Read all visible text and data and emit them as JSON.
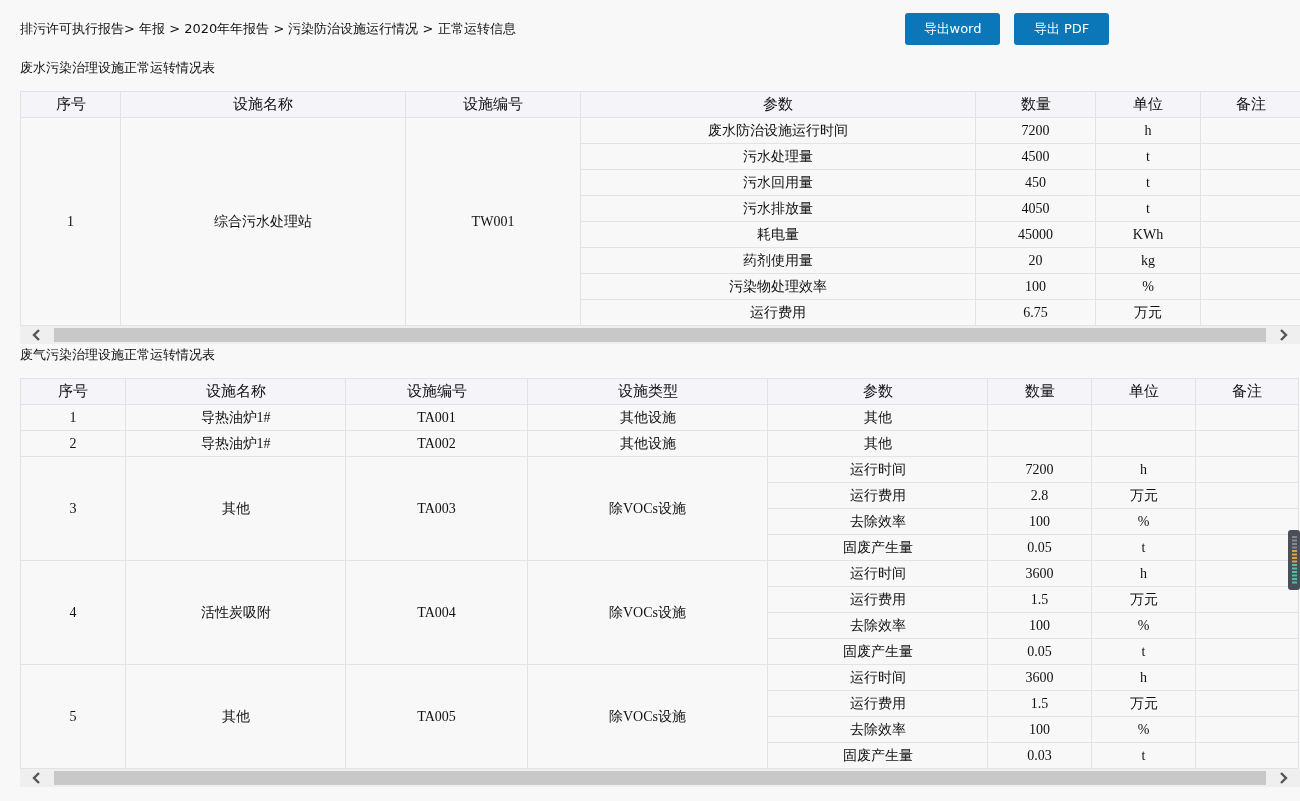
{
  "breadcrumb": "排污许可执行报告> 年报 > 2020年年报告 > 污染防治设施运行情况 > 正常运转信息",
  "buttons": [
    "导出word",
    "导出 PDF"
  ],
  "tables": [
    {
      "title": "废水污染治理设施正常运转情况表",
      "columns": [
        "序号",
        "设施名称",
        "设施编号",
        "参数",
        "数量",
        "单位",
        "备注"
      ],
      "rows": [
        {
          "no": "1",
          "name": "综合污水处理站",
          "code": "TW001",
          "params": [
            {
              "param": "废水防治设施运行时间",
              "qty": "7200",
              "unit": "h"
            },
            {
              "param": "污水处理量",
              "qty": "4500",
              "unit": "t"
            },
            {
              "param": "污水回用量",
              "qty": "450",
              "unit": "t"
            },
            {
              "param": "污水排放量",
              "qty": "4050",
              "unit": "t"
            },
            {
              "param": "耗电量",
              "qty": "45000",
              "unit": "KWh"
            },
            {
              "param": "药剂使用量",
              "qty": "20",
              "unit": "kg"
            },
            {
              "param": "污染物处理效率",
              "qty": "100",
              "unit": "%"
            },
            {
              "param": "运行费用",
              "qty": "6.75",
              "unit": "万元"
            }
          ]
        }
      ]
    },
    {
      "title": "废气污染治理设施正常运转情况表",
      "columns": [
        "序号",
        "设施名称",
        "设施编号",
        "设施类型",
        "参数",
        "数量",
        "单位",
        "备注"
      ],
      "rows": [
        {
          "no": "1",
          "name": "导热油炉1#",
          "code": "TA001",
          "type": "其他设施",
          "params": [
            {
              "param": "其他"
            }
          ]
        },
        {
          "no": "2",
          "name": "导热油炉1#",
          "code": "TA002",
          "type": "其他设施",
          "params": [
            {
              "param": "其他"
            }
          ]
        },
        {
          "no": "3",
          "name": "其他",
          "code": "TA003",
          "type": "除VOCs设施",
          "params": [
            {
              "param": "运行时间",
              "qty": "7200",
              "unit": "h"
            },
            {
              "param": "运行费用",
              "qty": "2.8",
              "unit": "万元"
            },
            {
              "param": "去除效率",
              "qty": "100",
              "unit": "%"
            },
            {
              "param": "固废产生量",
              "qty": "0.05",
              "unit": "t"
            }
          ]
        },
        {
          "no": "4",
          "name": "活性炭吸附",
          "code": "TA004",
          "type": "除VOCs设施",
          "params": [
            {
              "param": "运行时间",
              "qty": "3600",
              "unit": "h"
            },
            {
              "param": "运行费用",
              "qty": "1.5",
              "unit": "万元"
            },
            {
              "param": "去除效率",
              "qty": "100",
              "unit": "%"
            },
            {
              "param": "固废产生量",
              "qty": "0.05",
              "unit": "t"
            }
          ]
        },
        {
          "no": "5",
          "name": "其他",
          "code": "TA005",
          "type": "除VOCs设施",
          "params": [
            {
              "param": "运行时间",
              "qty": "3600",
              "unit": "h"
            },
            {
              "param": "运行费用",
              "qty": "1.5",
              "unit": "万元"
            },
            {
              "param": "去除效率",
              "qty": "100",
              "unit": "%"
            },
            {
              "param": "固废产生量",
              "qty": "0.03",
              "unit": "t"
            }
          ]
        }
      ]
    }
  ]
}
